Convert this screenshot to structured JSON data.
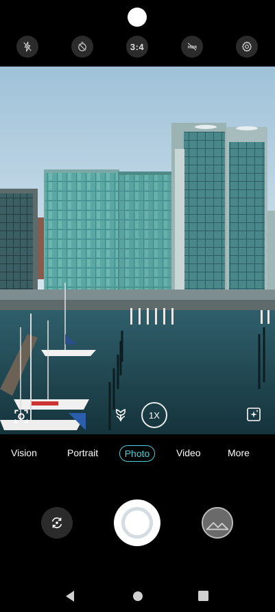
{
  "top_controls": {
    "flash": "flash-off-icon",
    "timer": "timer-off-icon",
    "aspect_ratio": "3:4",
    "hdr": "hdr-off-icon",
    "settings": "gear-icon"
  },
  "viewfinder": {
    "zoom_label": "1X"
  },
  "modes": [
    {
      "label": "Vision"
    },
    {
      "label": "Portrait"
    },
    {
      "label": "Photo"
    },
    {
      "label": "Video"
    },
    {
      "label": "More"
    }
  ],
  "colors": {
    "accent": "#4fd1d9",
    "background": "#000000"
  }
}
